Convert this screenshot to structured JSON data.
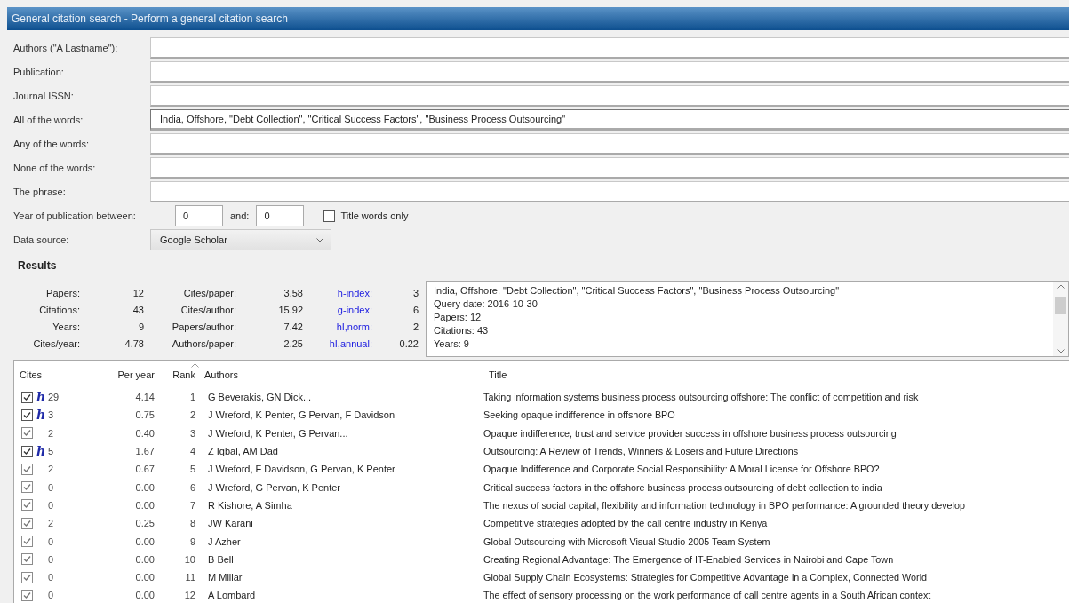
{
  "window": {
    "title": "General citation search - Perform a general citation search"
  },
  "search_fields": [
    {
      "label": "Authors (\"A Lastname\"):"
    },
    {
      "label": "Publication:"
    },
    {
      "label": "Journal ISSN:"
    },
    {
      "label": "All of the words:",
      "value": "India, Offshore, \"Debt Collection\", \"Critical Success Factors\", \"Business Process Outsourcing\""
    },
    {
      "label": "Any of the words:"
    },
    {
      "label": "None of the words:"
    },
    {
      "label": "The phrase:"
    }
  ],
  "year_range": {
    "label": "Year of publication between:",
    "from": "0",
    "and_label": "and:",
    "to": "0",
    "title_words_only": {
      "label": "Title words only",
      "checked": false
    }
  },
  "data_source": {
    "label": "Data source:",
    "value": "Google Scholar"
  },
  "results": {
    "heading": "Results",
    "stats": [
      {
        "label": "Papers:",
        "value": "12",
        "label_2": "Cites/paper:",
        "value_2": "3.58",
        "label_3": "h-index:",
        "value_3": "3"
      },
      {
        "label": "Citations:",
        "value": "43",
        "label_2": "Cites/author:",
        "value_2": "15.92",
        "label_3": "g-index:",
        "value_3": "6"
      },
      {
        "label": "Years:",
        "value": "9",
        "label_2": "Papers/author:",
        "value_2": "7.42",
        "label_3": "hI,norm:",
        "value_3": "2"
      },
      {
        "label": "Cites/year:",
        "value": "4.78",
        "label_2": "Authors/paper:",
        "value_2": "2.25",
        "label_3": "hI,annual:",
        "value_3": "0.22"
      }
    ],
    "query_summary": [
      "India, Offshore, \"Debt Collection\", \"Critical Success Factors\", \"Business Process Outsourcing\"",
      "Query date: 2016-10-30",
      "Papers: 12",
      "Citations: 43",
      "Years: 9"
    ]
  },
  "table": {
    "columns": [
      "Cites",
      "Per year",
      "Rank",
      "Authors",
      "Title"
    ],
    "rows": [
      {
        "checked": true,
        "h_mark": "h",
        "cites": "29",
        "per_year": "4.14",
        "rank": "1",
        "authors": "G Beverakis, GN Dick...",
        "title": "Taking information systems business process outsourcing offshore: The conflict of competition and risk"
      },
      {
        "checked": true,
        "h_mark": "h",
        "cites": "3",
        "per_year": "0.75",
        "rank": "2",
        "authors": "J Wreford, K Penter, G Pervan, F Davidson",
        "title": "Seeking opaque indifference in offshore BPO"
      },
      {
        "checked": true,
        "cites": "2",
        "per_year": "0.40",
        "rank": "3",
        "authors": "J Wreford, K Penter, G Pervan...",
        "title": "Opaque indifference, trust and service provider success in offshore business process outsourcing"
      },
      {
        "checked": true,
        "h_mark": "h",
        "cites": "5",
        "per_year": "1.67",
        "rank": "4",
        "authors": "Z Iqbal, AM Dad",
        "title": "Outsourcing: A Review of Trends, Winners & Losers and Future Directions"
      },
      {
        "checked": true,
        "cites": "2",
        "per_year": "0.67",
        "rank": "5",
        "authors": "J Wreford, F Davidson, G Pervan, K Penter",
        "title": "Opaque Indifference and Corporate Social Responsibility: A Moral License for Offshore BPO?"
      },
      {
        "checked": true,
        "cites": "0",
        "per_year": "0.00",
        "rank": "6",
        "authors": "J Wreford, G Pervan, K Penter",
        "title": "Critical success factors in the offshore business process outsourcing of debt collection to india"
      },
      {
        "checked": true,
        "cites": "0",
        "per_year": "0.00",
        "rank": "7",
        "authors": "R Kishore, A Simha",
        "title": "The nexus of social capital, flexibility and information technology in BPO performance: A grounded theory develop"
      },
      {
        "checked": true,
        "cites": "2",
        "per_year": "0.25",
        "rank": "8",
        "authors": "JW Karani",
        "title": "Competitive strategies adopted by the call centre industry in Kenya"
      },
      {
        "checked": true,
        "cites": "0",
        "per_year": "0.00",
        "rank": "9",
        "authors": "J Azher",
        "title": "Global Outsourcing with Microsoft Visual Studio 2005 Team System"
      },
      {
        "checked": true,
        "cites": "0",
        "per_year": "0.00",
        "rank": "10",
        "authors": "B Bell",
        "title": "Creating Regional Advantage: The Emergence of IT-Enabled Services in Nairobi and Cape Town"
      },
      {
        "checked": true,
        "cites": "0",
        "per_year": "0.00",
        "rank": "11",
        "authors": "M Millar",
        "title": "Global Supply Chain Ecosystems: Strategies for Competitive Advantage in a Complex, Connected World"
      },
      {
        "checked": true,
        "cites": "0",
        "per_year": "0.00",
        "rank": "12",
        "authors": "A Lombard",
        "title": "The effect of sensory processing on the work performance of call centre agents in a South African context"
      }
    ]
  }
}
